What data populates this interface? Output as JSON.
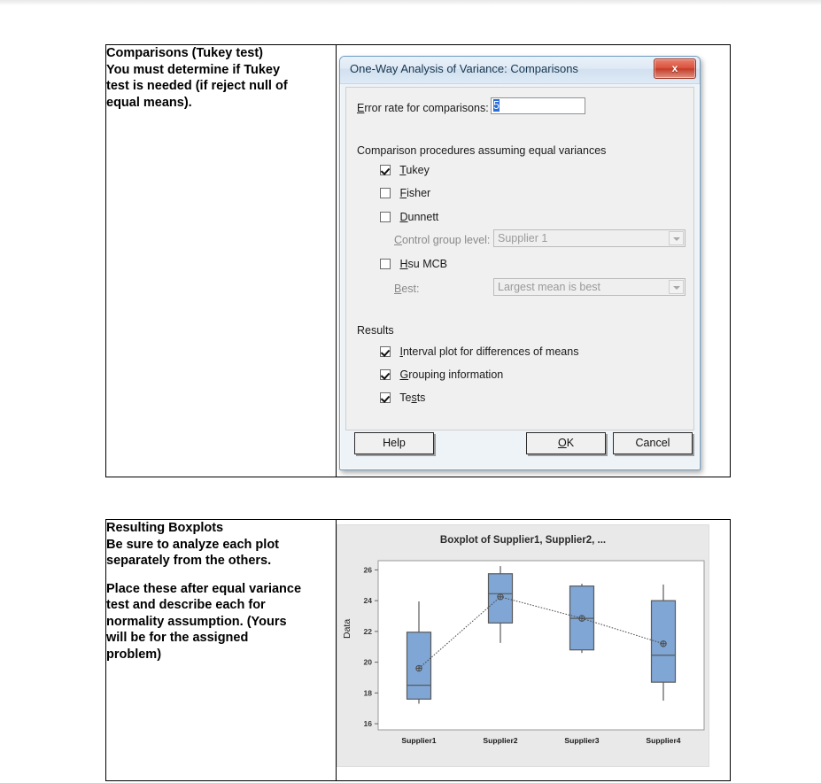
{
  "sections": [
    {
      "note_paragraphs": [
        "Comparisons (Tukey test)\nYou must determine if Tukey\ntest is needed (if reject null of\nequal means)."
      ]
    },
    {
      "note_paragraphs": [
        "Resulting Boxplots\nBe sure to analyze each plot\nseparately from the others.",
        "Place these after equal variance\ntest and describe each for\nnormality assumption. (Yours\nwill be for the assigned\nproblem)"
      ]
    }
  ],
  "dialog": {
    "title": "One-Way Analysis of Variance: Comparisons",
    "close_label": "x",
    "error_rate": {
      "label": "Error rate for comparisons:",
      "value": "5"
    },
    "equal_variances": {
      "group_label": "Comparison procedures assuming equal variances",
      "checkboxes": [
        {
          "label": "Tukey",
          "checked": true
        },
        {
          "label": "Fisher",
          "checked": false
        },
        {
          "label": "Dunnett",
          "checked": false
        },
        {
          "label": "Hsu MCB",
          "checked": false
        }
      ],
      "control_group": {
        "label": "Control group level:",
        "value": "Supplier 1",
        "enabled": false
      },
      "best": {
        "label": "Best:",
        "value": "Largest mean is best",
        "enabled": false
      }
    },
    "results": {
      "group_label": "Results",
      "checkboxes": [
        {
          "label": "Interval plot for differences of means",
          "checked": true
        },
        {
          "label": "Grouping information",
          "checked": true
        },
        {
          "label": "Tests",
          "checked": true
        }
      ]
    },
    "buttons": {
      "help": "Help",
      "ok": "OK",
      "cancel": "Cancel"
    }
  },
  "chart_data": {
    "type": "box",
    "title": "Boxplot of Supplier1, Supplier2, ...",
    "xlabel": "",
    "ylabel": "Data",
    "categories": [
      "Supplier1",
      "Supplier2",
      "Supplier3",
      "Supplier4"
    ],
    "yticks": [
      16,
      18,
      20,
      22,
      24,
      26
    ],
    "ylim": [
      15.6,
      26.6
    ],
    "grid": false,
    "legend": "none",
    "box_color": "#7fa6d4",
    "line_color": "#5a5a5a",
    "mean_connect_line": true,
    "boxes": [
      {
        "category": "Supplier1",
        "whisker_low": 17.3,
        "q1": 17.6,
        "median": 18.5,
        "q3": 21.95,
        "whisker_high": 23.95,
        "mean": 19.6
      },
      {
        "category": "Supplier2",
        "whisker_low": 21.25,
        "q1": 22.55,
        "median": 24.45,
        "q3": 25.75,
        "whisker_high": 26.25,
        "mean": 24.25
      },
      {
        "category": "Supplier3",
        "whisker_low": 20.6,
        "q1": 20.8,
        "median": 22.85,
        "q3": 24.95,
        "whisker_high": 25.1,
        "mean": 22.85
      },
      {
        "category": "Supplier4",
        "whisker_low": 17.5,
        "q1": 18.7,
        "median": 20.45,
        "q3": 24.0,
        "whisker_high": 25.05,
        "mean": 21.2
      }
    ]
  }
}
